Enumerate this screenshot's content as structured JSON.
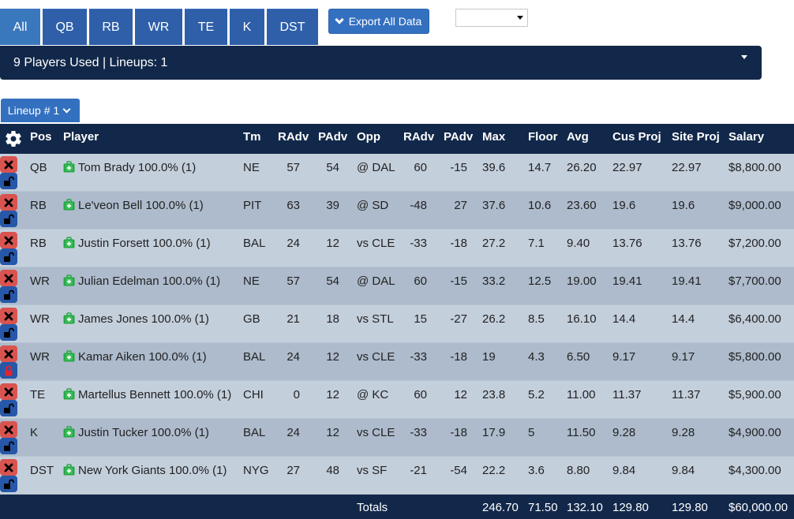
{
  "position_tabs": [
    {
      "label": "All",
      "active": true
    },
    {
      "label": "QB",
      "active": false
    },
    {
      "label": "RB",
      "active": false
    },
    {
      "label": "WR",
      "active": false
    },
    {
      "label": "TE",
      "active": false
    },
    {
      "label": "K",
      "active": false
    },
    {
      "label": "DST",
      "active": false
    }
  ],
  "toolbar": {
    "export_label": "Export All Data",
    "select_value": ""
  },
  "summary": {
    "text": "9 Players Used | Lineups: 1"
  },
  "lineup_selector": {
    "label": "Lineup # 1"
  },
  "colors": {
    "navy": "#12284a",
    "primary_blue": "#3470c0",
    "remove_red": "#d9534f",
    "lock_blue": "#2657a8",
    "locked_red": "#e8202a",
    "injury_green": "#28a745",
    "row_light": "#c4cfdc",
    "row_dark": "#adbbcc"
  },
  "table": {
    "headers": [
      "Pos",
      "Player",
      "Tm",
      "RAdv",
      "PAdv",
      "Opp",
      "RAdv",
      "PAdv",
      "Max",
      "Floor",
      "Avg",
      "Cus Proj",
      "Site Proj",
      "Salary"
    ],
    "rows": [
      {
        "pos": "QB",
        "player": "Tom Brady 100.0% (1)",
        "tm": "NE",
        "radv": "57",
        "padv": "54",
        "opp": "@ DAL",
        "radv2": "60",
        "padv2": "-15",
        "max": "39.6",
        "floor": "14.7",
        "avg": "26.20",
        "cus_proj": "22.97",
        "site_proj": "22.97",
        "salary": "$8,800.00",
        "locked": false
      },
      {
        "pos": "RB",
        "player": "Le'veon Bell 100.0% (1)",
        "tm": "PIT",
        "radv": "63",
        "padv": "39",
        "opp": "@ SD",
        "radv2": "-48",
        "padv2": "27",
        "max": "37.6",
        "floor": "10.6",
        "avg": "23.60",
        "cus_proj": "19.6",
        "site_proj": "19.6",
        "salary": "$9,000.00",
        "locked": false
      },
      {
        "pos": "RB",
        "player": "Justin Forsett 100.0% (1)",
        "tm": "BAL",
        "radv": "24",
        "padv": "12",
        "opp": "vs CLE",
        "radv2": "-33",
        "padv2": "-18",
        "max": "27.2",
        "floor": "7.1",
        "avg": "9.40",
        "cus_proj": "13.76",
        "site_proj": "13.76",
        "salary": "$7,200.00",
        "locked": false
      },
      {
        "pos": "WR",
        "player": "Julian Edelman 100.0% (1)",
        "tm": "NE",
        "radv": "57",
        "padv": "54",
        "opp": "@ DAL",
        "radv2": "60",
        "padv2": "-15",
        "max": "33.2",
        "floor": "12.5",
        "avg": "19.00",
        "cus_proj": "19.41",
        "site_proj": "19.41",
        "salary": "$7,700.00",
        "locked": false
      },
      {
        "pos": "WR",
        "player": "James Jones 100.0% (1)",
        "tm": "GB",
        "radv": "21",
        "padv": "18",
        "opp": "vs STL",
        "radv2": "15",
        "padv2": "-27",
        "max": "26.2",
        "floor": "8.5",
        "avg": "16.10",
        "cus_proj": "14.4",
        "site_proj": "14.4",
        "salary": "$6,400.00",
        "locked": false
      },
      {
        "pos": "WR",
        "player": "Kamar Aiken 100.0% (1)",
        "tm": "BAL",
        "radv": "24",
        "padv": "12",
        "opp": "vs CLE",
        "radv2": "-33",
        "padv2": "-18",
        "max": "19",
        "floor": "4.3",
        "avg": "6.50",
        "cus_proj": "9.17",
        "site_proj": "9.17",
        "salary": "$5,800.00",
        "locked": true
      },
      {
        "pos": "TE",
        "player": "Martellus Bennett 100.0% (1)",
        "tm": "CHI",
        "radv": "0",
        "padv": "12",
        "opp": "@ KC",
        "radv2": "60",
        "padv2": "12",
        "max": "23.8",
        "floor": "5.2",
        "avg": "11.00",
        "cus_proj": "11.37",
        "site_proj": "11.37",
        "salary": "$5,900.00",
        "locked": false
      },
      {
        "pos": "K",
        "player": "Justin Tucker 100.0% (1)",
        "tm": "BAL",
        "radv": "24",
        "padv": "12",
        "opp": "vs CLE",
        "radv2": "-33",
        "padv2": "-18",
        "max": "17.9",
        "floor": "5",
        "avg": "11.50",
        "cus_proj": "9.28",
        "site_proj": "9.28",
        "salary": "$4,900.00",
        "locked": false
      },
      {
        "pos": "DST",
        "player": "New York Giants 100.0% (1)",
        "tm": "NYG",
        "radv": "27",
        "padv": "48",
        "opp": "vs SF",
        "radv2": "-21",
        "padv2": "-54",
        "max": "22.2",
        "floor": "3.6",
        "avg": "8.80",
        "cus_proj": "9.84",
        "site_proj": "9.84",
        "salary": "$4,300.00",
        "locked": false
      }
    ],
    "totals": {
      "label": "Totals",
      "max": "246.70",
      "floor": "71.50",
      "avg": "132.10",
      "cus_proj": "129.80",
      "site_proj": "129.80",
      "salary": "$60,000.00"
    }
  }
}
